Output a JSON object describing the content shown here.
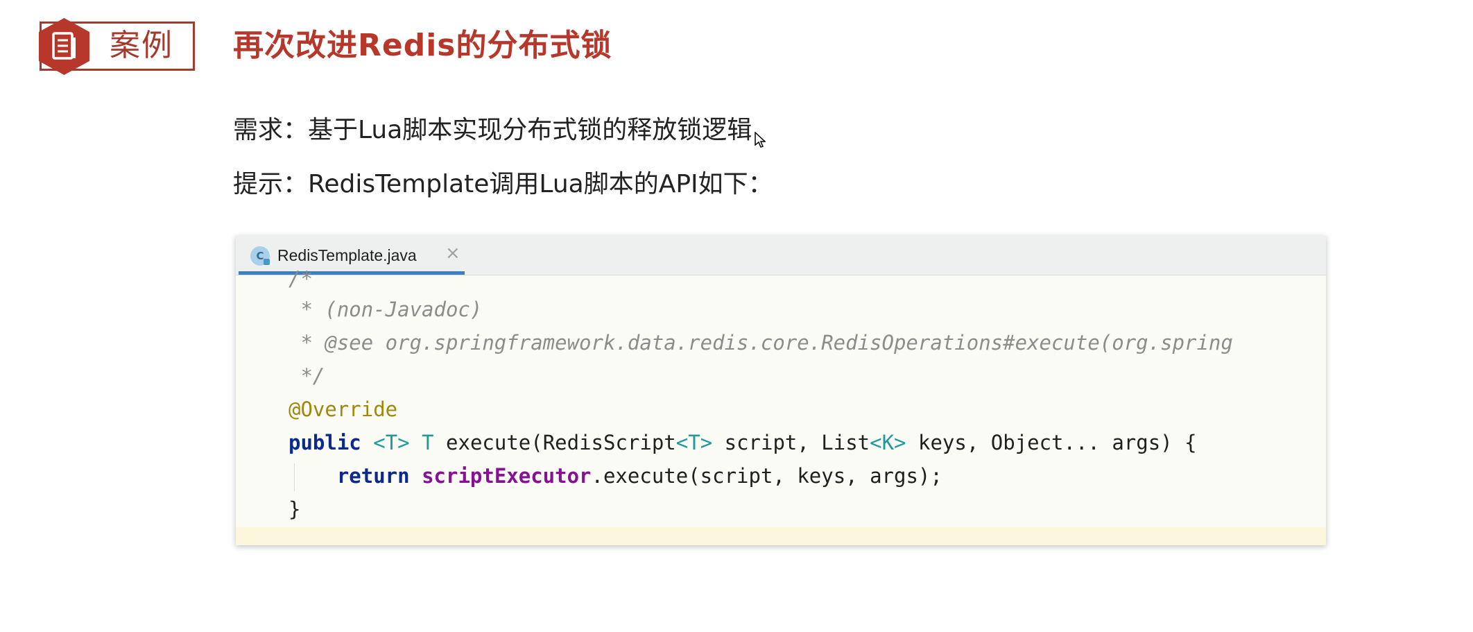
{
  "header": {
    "tag_label": "案例",
    "title": "再次改进Redis的分布式锁"
  },
  "body": {
    "requirement": "需求：基于Lua脚本实现分布式锁的释放锁逻辑",
    "hint": "提示：RedisTemplate调用Lua脚本的API如下："
  },
  "editor": {
    "tab": {
      "icon_letter": "C",
      "filename": "RedisTemplate.java",
      "close": "×"
    },
    "code": {
      "l0": "/*",
      "l1": " * (non-Javadoc)",
      "l2": " * @see org.springframework.data.redis.core.RedisOperations#execute(org.spring",
      "l3": " */",
      "l4": "@Override",
      "l5": {
        "kw": "public",
        "sp1": " ",
        "t1": "<T>",
        "sp2": " ",
        "t2": "T",
        "mid": " execute(RedisScript",
        "t3": "<T>",
        "mid2": " script, List",
        "t4": "<K>",
        "end": " keys, Object... args) {"
      },
      "l6": {
        "indent": "    ",
        "kw": "return",
        "sp": " ",
        "field": "scriptExecutor",
        "rest": ".execute(script, keys, args);"
      },
      "l7": "}"
    }
  },
  "colors": {
    "accent": "#b7372a",
    "tag_border": "#a33a2c",
    "tab_underline": "#3d7fc1",
    "keyword": "#0b2a8a",
    "annotation": "#9e880d",
    "comment": "#8c8c8c",
    "field": "#871094",
    "type_param": "#20999d"
  },
  "icons": {
    "tag_icon": "document-icon",
    "tab_icon": "java-class-icon",
    "cursor": "mouse-cursor-icon"
  }
}
